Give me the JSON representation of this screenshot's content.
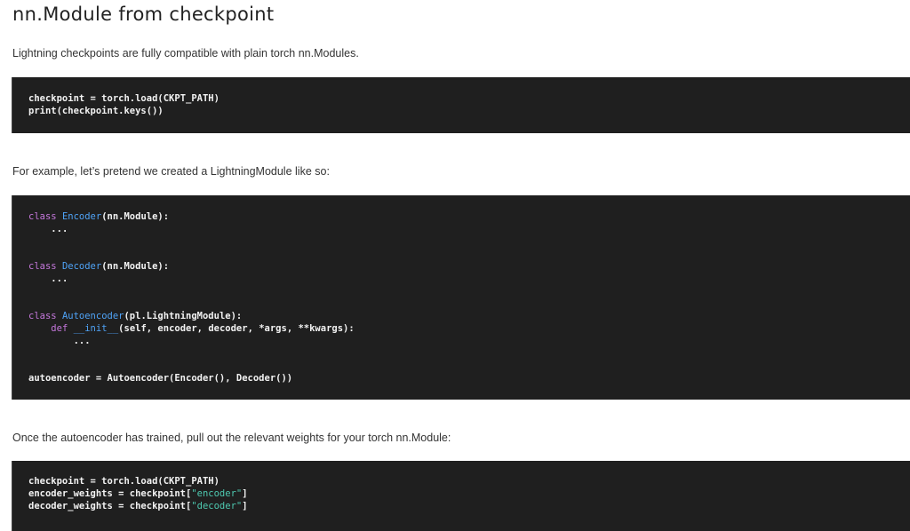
{
  "page": {
    "title": "nn.Module from checkpoint"
  },
  "paragraphs": {
    "intro": "Lightning checkpoints are fully compatible with plain torch nn.Modules.",
    "example": "For example, let’s pretend we created a LightningModule like so:",
    "after": "Once the autoencoder has trained, pull out the relevant weights for your torch nn.Module:"
  },
  "code1": {
    "line1_a": "checkpoint",
    "line1_b": " = torch.load",
    "line1_c": "(CKPT_PATH)",
    "line2_a": "print",
    "line2_b": "(checkpoint.keys())"
  },
  "code2": {
    "kw_class": "class",
    "encoder_name": "Encoder",
    "encoder_base": "(nn.Module):",
    "ellipsis": "...",
    "decoder_name": "Decoder",
    "decoder_base": "(nn.Module):",
    "auto_name": "Autoencoder",
    "auto_base": "(pl.LightningModule):",
    "kw_def": "def",
    "init_name": "__init__",
    "init_args": "(self, encoder, decoder, *args, **kwargs):",
    "last_line": "autoencoder = Autoencoder(Encoder(), Decoder())"
  },
  "code3": {
    "line1": "checkpoint = torch.load(CKPT_PATH)",
    "line2_a": "encoder_weights = checkpoint[",
    "line2_str": "\"encoder\"",
    "line2_c": "]",
    "line3_a": "decoder_weights = checkpoint[",
    "line3_str": "\"decoder\"",
    "line3_c": "]"
  }
}
